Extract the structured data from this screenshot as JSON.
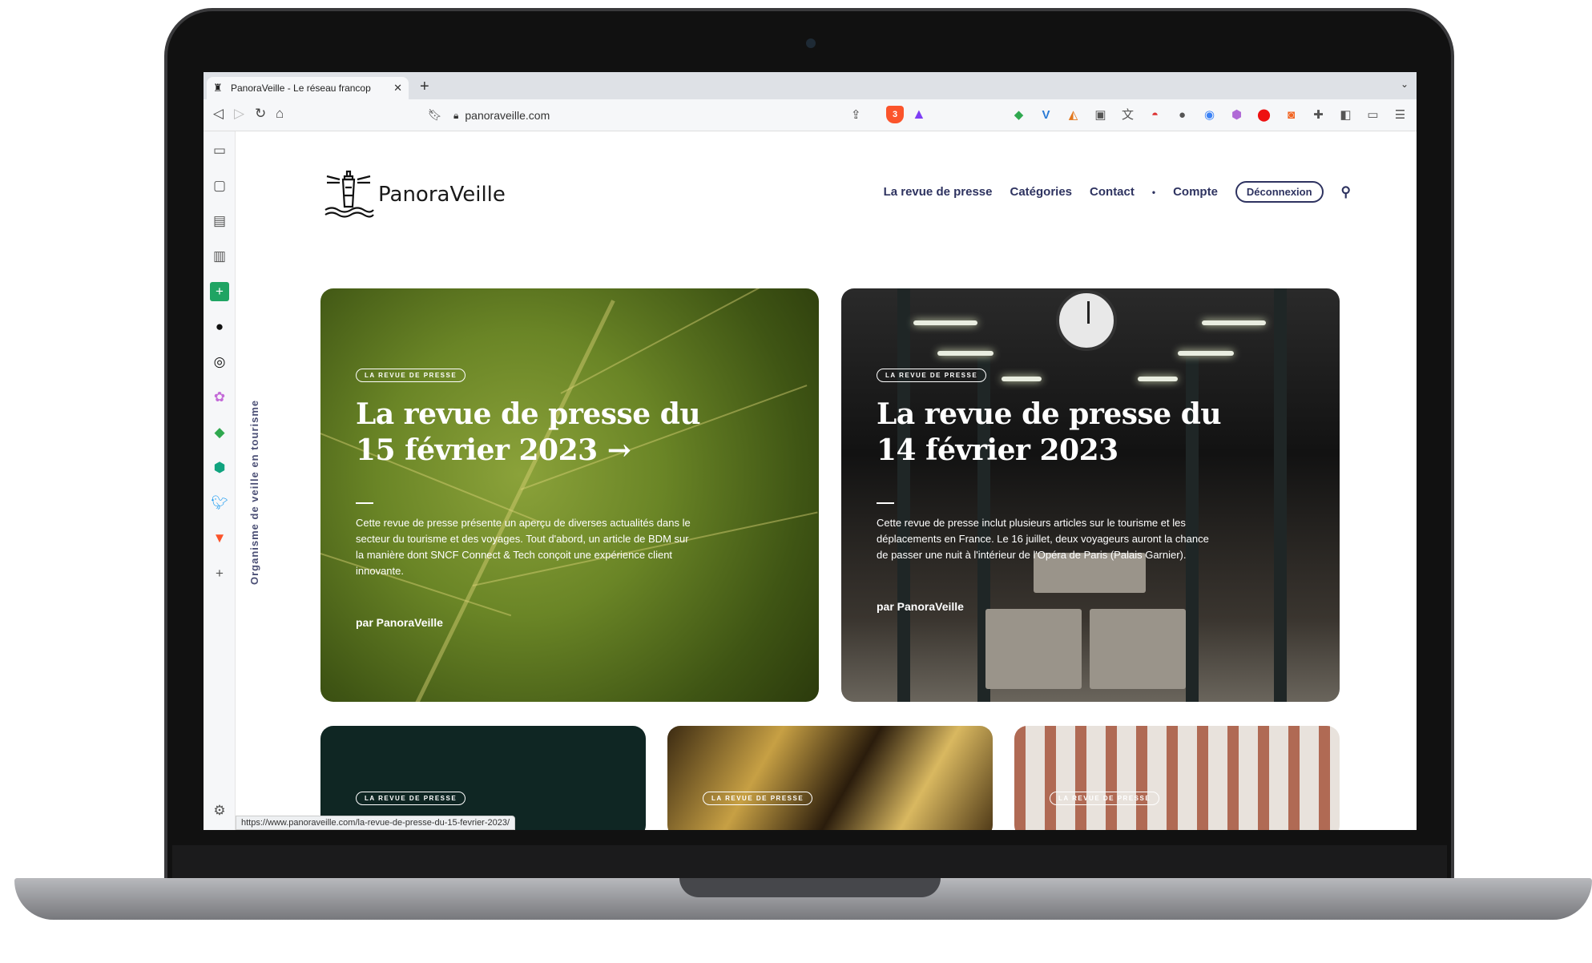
{
  "browser": {
    "tab_title": "PanoraVeille - Le réseau francop",
    "url": "panoraveille.com",
    "status_url": "https://www.panoraveille.com/la-revue-de-presse-du-15-fevrier-2023/",
    "shield_count": "3"
  },
  "site": {
    "logo_text": "PanoraVeille",
    "vertical_tagline": "Organisme de veille en tourisme",
    "nav": [
      "La revue de presse",
      "Catégories",
      "Contact",
      "Compte"
    ],
    "logout_label": "Déconnexion"
  },
  "cards": [
    {
      "badge": "LA REVUE DE PRESSE",
      "title": "La revue de presse du 15 février 2023 →",
      "excerpt": "Cette revue de presse présente un aperçu de diverses actualités dans le secteur du tourisme et des voyages. Tout d'abord, un article de BDM sur la manière dont SNCF Connect & Tech conçoit une expérience client innovante.",
      "byline": "par PanoraVeille"
    },
    {
      "badge": "LA REVUE DE PRESSE",
      "title": "La revue de presse du 14 février 2023",
      "excerpt": "Cette revue de presse inclut plusieurs articles sur le tourisme et les déplacements en France. Le 16 juillet, deux voyageurs auront la chance de passer une nuit à l'intérieur de l'Opéra de Paris (Palais Garnier).",
      "byline": "par PanoraVeille"
    }
  ],
  "small_cards": [
    {
      "badge": "LA REVUE DE PRESSE"
    },
    {
      "badge": "LA REVUE DE PRESSE"
    },
    {
      "badge": "LA REVUE DE PRESSE"
    }
  ]
}
